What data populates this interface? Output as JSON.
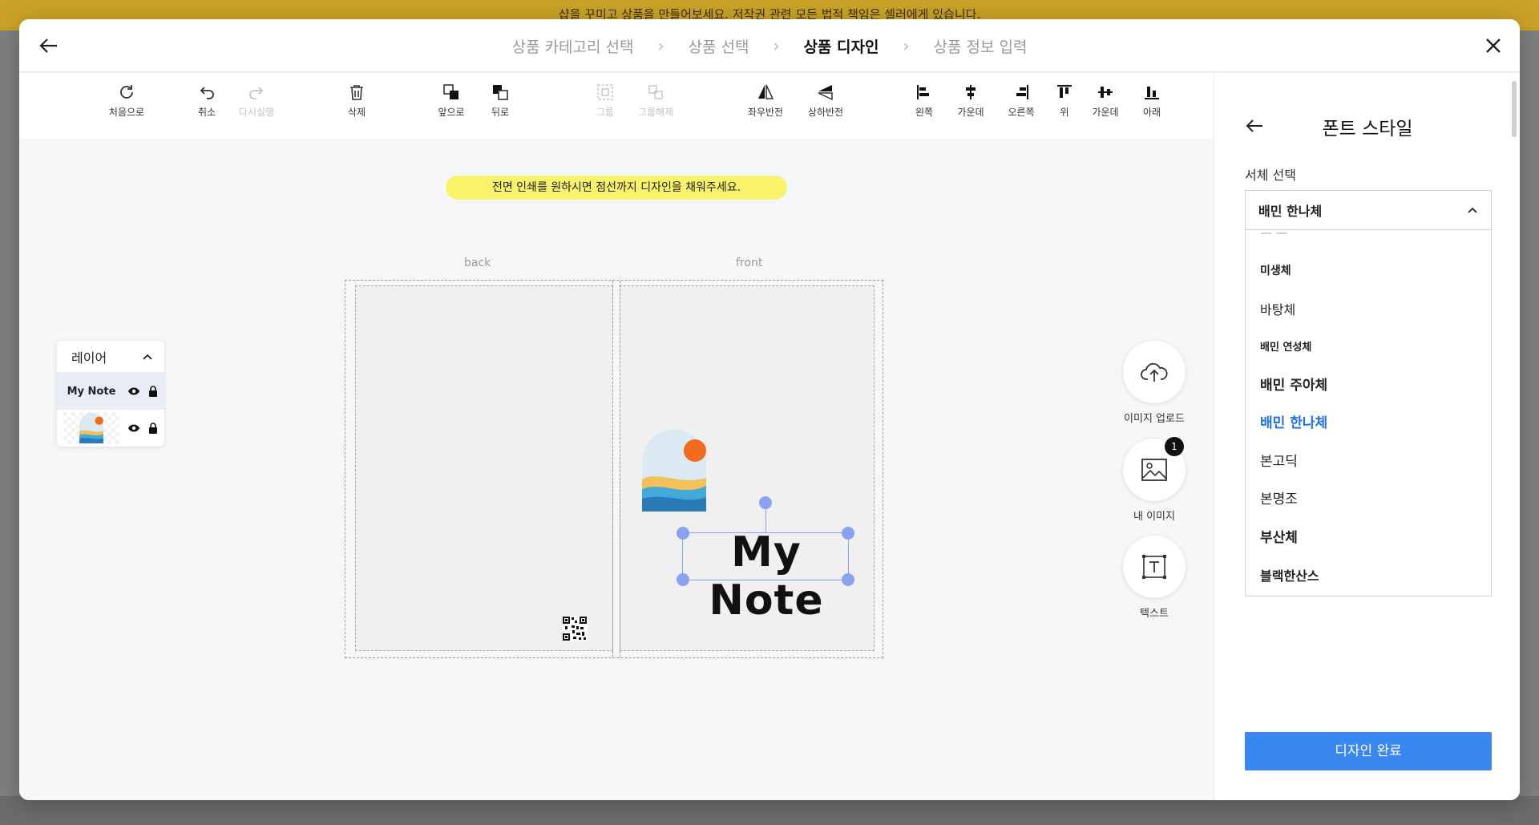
{
  "notice": "샵을 꾸미고 상품을 만들어보세요. 저작권 관련 모든 법적 책임은 셀러에게 있습니다.",
  "steps": [
    {
      "label": "상품 카테고리 선택"
    },
    {
      "label": "상품 선택"
    },
    {
      "label": "상품 디자인"
    },
    {
      "label": "상품 정보 입력"
    }
  ],
  "active_step": "상품 디자인",
  "toolbar": {
    "reset": "처음으로",
    "undo": "취소",
    "redo": "다시실행",
    "delete": "삭제",
    "forward": "앞으로",
    "backward": "뒤로",
    "group": "그룹",
    "ungroup": "그룹해제",
    "flip_h": "좌우반전",
    "flip_v": "상하반전",
    "align_left": "왼쪽",
    "align_center_h": "가운데",
    "align_right": "오른쪽",
    "align_top": "위",
    "align_middle_v": "가운데",
    "align_bottom": "아래"
  },
  "canvas": {
    "tip": "전면 인쇄를 원하시면 점선까지 디자인을 채워주세요.",
    "back_label": "back",
    "front_label": "front",
    "text_object": "My Note"
  },
  "layers": {
    "title": "레이어",
    "items": [
      {
        "thumb_text": "My Note"
      },
      {
        "thumb_text": ""
      }
    ]
  },
  "side_buttons": {
    "upload": "이미지 업로드",
    "my_images": "내 이미지",
    "my_images_count": "1",
    "text": "텍스트"
  },
  "font_panel": {
    "title": "폰트 스타일",
    "label": "서체 선택",
    "selected": "배민 한나체",
    "options": [
      {
        "label": "미생체"
      },
      {
        "label": "바탕체"
      },
      {
        "label": "배민 연성체"
      },
      {
        "label": "배민 주아체"
      },
      {
        "label": "배민 한나체"
      },
      {
        "label": "본고딕"
      },
      {
        "label": "본명조"
      },
      {
        "label": "부산체"
      },
      {
        "label": "블랙한산스"
      }
    ],
    "done_button": "디자인 완료"
  },
  "colors": {
    "accent": "#3a87f2",
    "selected_font": "#1e72e8",
    "highlight": "#f7ef2b",
    "handle": "#8aa2f0"
  }
}
